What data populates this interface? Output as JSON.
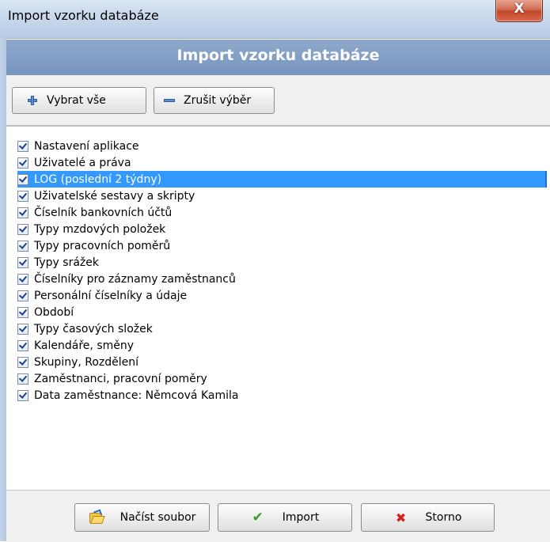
{
  "window": {
    "title": "Import vzorku databáze",
    "close_glyph": "X"
  },
  "header": {
    "title": "Import vzorku databáze"
  },
  "toolbar": {
    "select_all_label": "Vybrat vše",
    "select_all_icon": "plus-icon",
    "deselect_label": "Zrušit výběr",
    "deselect_icon": "minus-icon"
  },
  "list": {
    "items": [
      {
        "label": "Nastavení aplikace",
        "checked": true,
        "selected": false
      },
      {
        "label": "Uživatelé a práva",
        "checked": true,
        "selected": false
      },
      {
        "label": "LOG (poslední 2 týdny)",
        "checked": true,
        "selected": true
      },
      {
        "label": "Uživatelské sestavy a skripty",
        "checked": true,
        "selected": false
      },
      {
        "label": "Číselník bankovních účtů",
        "checked": true,
        "selected": false
      },
      {
        "label": "Typy mzdových položek",
        "checked": true,
        "selected": false
      },
      {
        "label": "Typy pracovních poměrů",
        "checked": true,
        "selected": false
      },
      {
        "label": "Typy srážek",
        "checked": true,
        "selected": false
      },
      {
        "label": "Číselníky pro záznamy zaměstnanců",
        "checked": true,
        "selected": false
      },
      {
        "label": "Personální číselníky a údaje",
        "checked": true,
        "selected": false
      },
      {
        "label": "Období",
        "checked": true,
        "selected": false
      },
      {
        "label": "Typy časových složek",
        "checked": true,
        "selected": false
      },
      {
        "label": "Kalendáře, směny",
        "checked": true,
        "selected": false
      },
      {
        "label": "Skupiny, Rozdělení",
        "checked": true,
        "selected": false
      },
      {
        "label": "Zaměstnanci, pracovní poměry",
        "checked": true,
        "selected": false
      },
      {
        "label": "Data zaměstnance: Němcová  Kamila",
        "checked": true,
        "selected": false
      }
    ]
  },
  "footer": {
    "load_file_label": "Načíst soubor",
    "import_label": "Import",
    "cancel_label": "Storno"
  },
  "colors": {
    "header_band": "#7f9cc4",
    "selection": "#3399ff",
    "close_button": "#c4472b"
  }
}
